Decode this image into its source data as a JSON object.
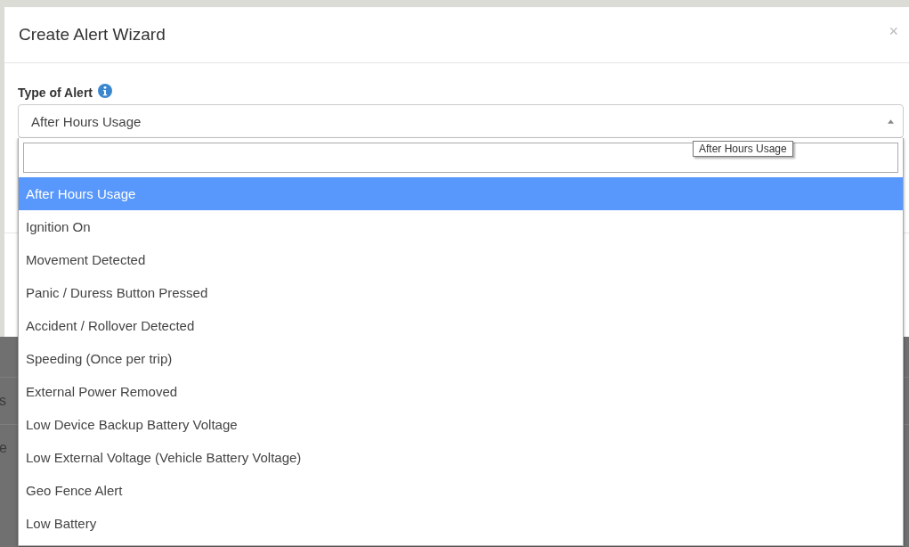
{
  "modal": {
    "title": "Create Alert Wizard",
    "close": "×"
  },
  "field": {
    "label": "Type of Alert",
    "value": "After Hours Usage",
    "expanded": true
  },
  "dropdown": {
    "tooltip": "After Hours Usage",
    "options": [
      {
        "label": "After Hours Usage",
        "selected": true
      },
      {
        "label": "Ignition On",
        "selected": false
      },
      {
        "label": "Movement Detected",
        "selected": false
      },
      {
        "label": "Panic / Duress Button Pressed",
        "selected": false
      },
      {
        "label": "Accident / Rollover Detected",
        "selected": false
      },
      {
        "label": "Speeding (Once per trip)",
        "selected": false
      },
      {
        "label": "External Power Removed",
        "selected": false
      },
      {
        "label": "Low Device Backup Battery Voltage",
        "selected": false
      },
      {
        "label": "Low External Voltage (Vehicle Battery Voltage)",
        "selected": false
      },
      {
        "label": "Geo Fence Alert",
        "selected": false
      },
      {
        "label": "Low Battery",
        "selected": false
      }
    ]
  },
  "background_rows": [
    "s",
    "e"
  ]
}
